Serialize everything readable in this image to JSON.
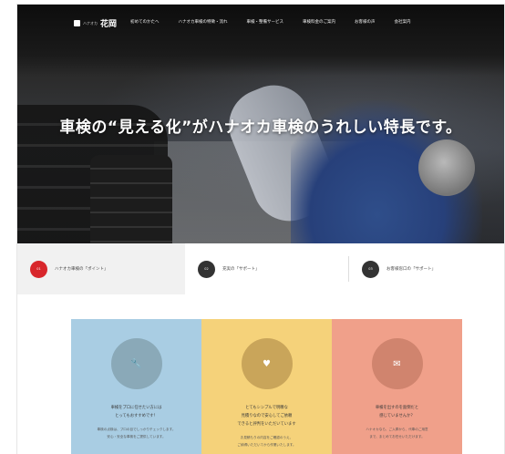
{
  "nav": {
    "logo_small": "ハナオカ",
    "logo_name": "花岡",
    "links": [
      "初めてのかたへ",
      "ハナオカ車検の特徴・流れ",
      "車検・整備サービス",
      "車検料金のご案内",
      "お客様の声",
      "会社案内"
    ]
  },
  "hero": {
    "headline": "車検の“見える化”がハナオカ車検のうれしい特長です。"
  },
  "tabs": [
    {
      "badge": "01",
      "label": "ハナオカ車検の「ポイント」",
      "color": "#d8262b"
    },
    {
      "badge": "02",
      "label": "充実の「サポート」",
      "color": "#333333"
    },
    {
      "badge": "03",
      "label": "お客様窓口の「サポート」",
      "color": "#333333"
    }
  ],
  "cards": [
    {
      "icon": "🔧",
      "bg": "#a9cde3",
      "circle": "#8aa9b8",
      "title": "車検をプロに任せたい方には\nとってもおすすめです！",
      "body": "車検の点検は、プロの目でしっかりチェックします。\n安心・安全な車検をご提供しています。"
    },
    {
      "icon": "♥",
      "bg": "#f5d27a",
      "circle": "#c9a55a",
      "title": "とてもシンプルで明瞭な\n見積りなので安心してご依頼\nできると評判をいただいています",
      "body": "お見積もりの内容をご確認のうえ、\nご納得いただいてから作業いたします。"
    },
    {
      "icon": "✉",
      "bg": "#f0a08a",
      "circle": "#d0846e",
      "title": "車検を出すのを面倒だと\n感じていませんか？",
      "body": "ハナオカなら、ご入庫から、代車のご用意\nまで、まとめてお任せいただけます。"
    }
  ]
}
